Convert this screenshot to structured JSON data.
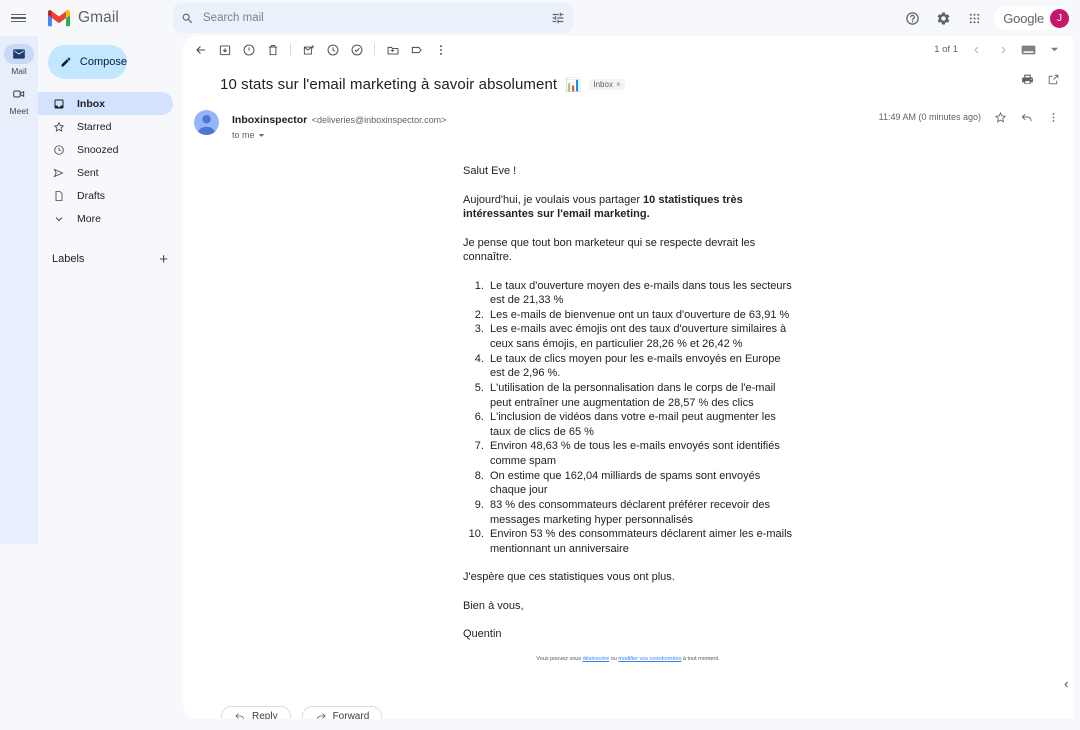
{
  "header": {
    "menu_icon": "hamburger-icon",
    "brand": "Gmail",
    "search": {
      "placeholder": "Search mail",
      "value": "",
      "icon": "search-icon",
      "options_icon": "search-options-icon"
    },
    "help_icon": "help-icon",
    "settings_icon": "gear-icon",
    "apps_icon": "apps-grid-icon",
    "google_label": "Google",
    "avatar_initial": "J",
    "avatar_color": "#c5176c"
  },
  "rail": {
    "items": [
      {
        "label": "Mail",
        "icon": "mail-icon",
        "active": true
      },
      {
        "label": "Meet",
        "icon": "video-camera-icon",
        "active": false
      }
    ]
  },
  "sidebar": {
    "compose": {
      "label": "Compose",
      "icon": "pencil-icon"
    },
    "items": [
      {
        "label": "Inbox",
        "icon": "inbox-icon",
        "active": true
      },
      {
        "label": "Starred",
        "icon": "star-icon",
        "active": false
      },
      {
        "label": "Snoozed",
        "icon": "clock-icon",
        "active": false
      },
      {
        "label": "Sent",
        "icon": "send-icon",
        "active": false
      },
      {
        "label": "Drafts",
        "icon": "draft-icon",
        "active": false
      },
      {
        "label": "More",
        "icon": "chevron-down-icon",
        "active": false
      }
    ],
    "labels_title": "Labels",
    "add_label_icon": "plus-icon"
  },
  "toolbar": {
    "back_icon": "arrow-back-icon",
    "archive_icon": "archive-icon",
    "spam_icon": "report-spam-icon",
    "delete_icon": "trash-icon",
    "mark_unread_icon": "mark-unread-icon",
    "snooze_icon": "clock-icon",
    "tasks_icon": "add-to-tasks-icon",
    "move_icon": "move-to-folder-icon",
    "labels_icon": "label-icon",
    "more_icon": "more-vertical-icon",
    "pager_text": "1 of 1",
    "prev_icon": "chevron-left-icon",
    "next_icon": "chevron-right-icon",
    "input_tools_icon": "keyboard-icon",
    "input_tools_caret": "caret-down-icon"
  },
  "message": {
    "subject": "10 stats sur l'email marketing à savoir absolument",
    "subject_emoji": "📊",
    "label_chip": "Inbox",
    "label_chip_remove": "×",
    "print_icon": "print-icon",
    "popout_icon": "open-in-new-icon",
    "sender_name": "Inboxinspector",
    "sender_email": "<deliveries@inboxinspector.com>",
    "recipient": "to me",
    "recipient_caret": "caret-down-icon",
    "timestamp": "11:49 AM (0 minutes ago)",
    "star_icon": "star-outline-icon",
    "reply_icon": "reply-arrow-icon",
    "more_icon": "more-vertical-icon"
  },
  "email_body": {
    "greeting": "Salut Eve !",
    "intro_prefix": "Aujourd'hui, je voulais vous partager ",
    "intro_bold": "10 statistiques très intéressantes sur l'email marketing.",
    "line3": "Je pense que tout bon marketeur qui se respecte devrait les connaître.",
    "stats": [
      "Le taux d'ouverture moyen des e-mails dans tous les secteurs est de 21,33 %",
      "Les e-mails de bienvenue ont un taux d'ouverture de 63,91 %",
      "Les e-mails avec émojis ont des taux d'ouverture similaires à ceux sans émojis, en particulier 28,26 % et 26,42 %",
      "Le taux de clics moyen pour les e-mails envoyés en Europe est de 2,96 %.",
      "L'utilisation de la personnalisation dans le corps de l'e-mail peut entraîner une augmentation de 28,57 % des clics",
      "L'inclusion de vidéos dans votre e-mail peut augmenter les taux de clics de 65 %",
      "Environ 48,63 % de tous les e-mails envoyés sont identifiés comme spam",
      "On estime que 162,04 milliards de spams sont envoyés chaque jour",
      "83 % des consommateurs déclarent préférer recevoir des messages marketing hyper personnalisés",
      "Environ 53 % des consommateurs déclarent aimer les e-mails mentionnant un anniversaire"
    ],
    "outro": "J'espère que ces statistiques vous ont plus.",
    "signoff": "Bien à vous,",
    "signature": "Quentin",
    "footer_prefix": "Vous pouvez vous ",
    "footer_link1": "désinscrire",
    "footer_mid": " ou ",
    "footer_link2": "modifier vos coordonnées",
    "footer_suffix": " à tout moment.",
    "link_color": "#3b82f6"
  },
  "actions": {
    "reply_label": "Reply",
    "reply_icon": "reply-arrow-icon",
    "forward_label": "Forward",
    "forward_icon": "forward-arrow-icon"
  },
  "collapse": {
    "icon": "chevron-left-icon"
  }
}
